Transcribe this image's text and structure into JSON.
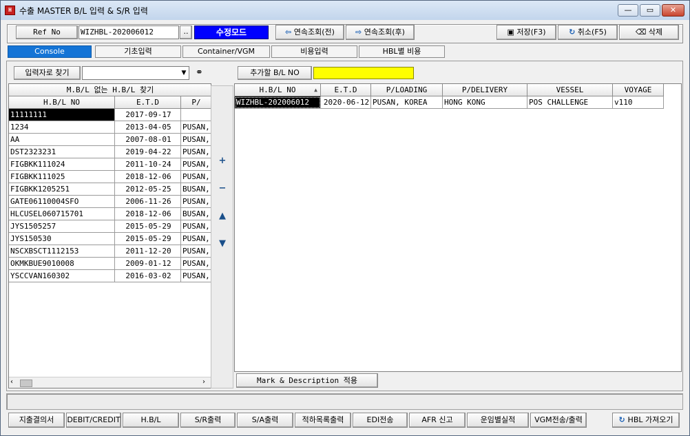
{
  "window": {
    "title": "수출 MASTER B/L 입력 & S/R 입력",
    "icon": "app-icon",
    "controls": [
      "minimize",
      "restore",
      "close"
    ]
  },
  "toolbar": {
    "ref_label": "Ref No",
    "ref_value": "WIZHBL-202006012",
    "dots": "..",
    "mode": "수정모드",
    "prev": "연속조회(전)",
    "next": "연속조회(후)",
    "save": "저장(F3)",
    "cancel": "취소(F5)",
    "delete": "삭제"
  },
  "tabs": [
    "Console",
    "기초입력",
    "Container/VGM",
    "비용입력",
    "HBL별 비용"
  ],
  "search": {
    "label": "입력자로 찾기",
    "value": "",
    "add_label": "추가할 B/L NO",
    "add_value": ""
  },
  "left": {
    "title": "M.B/L 없는 H.B/L 찾기",
    "columns": [
      "H.B/L NO",
      "E.T.D",
      "P/"
    ],
    "rows": [
      [
        "11111111",
        "2017-09-17",
        ""
      ],
      [
        "1234",
        "2013-04-05",
        "PUSAN, K"
      ],
      [
        "AA",
        "2007-08-01",
        "PUSAN, K"
      ],
      [
        "DST2323231",
        "2019-04-22",
        "PUSAN, K"
      ],
      [
        "FIGBKK111024",
        "2011-10-24",
        "PUSAN, K"
      ],
      [
        "FIGBKK111025",
        "2018-12-06",
        "PUSAN, K"
      ],
      [
        "FIGBKK1205251",
        "2012-05-25",
        "BUSAN, K"
      ],
      [
        "GATE06110004SFO",
        "2006-11-26",
        "PUSAN, K"
      ],
      [
        "HLCUSEL060715701",
        "2018-12-06",
        "BUSAN, K"
      ],
      [
        "JYS1505257",
        "2015-05-29",
        "PUSAN, K"
      ],
      [
        "JYS150530",
        "2015-05-29",
        "PUSAN, K"
      ],
      [
        "NSCXBSCT1112153",
        "2011-12-20",
        "PUSAN, K"
      ],
      [
        "OKMKBUE9010008",
        "2009-01-12",
        "PUSAN, K"
      ],
      [
        "YSCCVAN160302",
        "2016-03-02",
        "PUSAN, K"
      ]
    ]
  },
  "right": {
    "columns": [
      "H.B/L NO",
      "E.T.D",
      "P/LOADING",
      "P/DELIVERY",
      "VESSEL",
      "VOYAGE"
    ],
    "rows": [
      [
        "WIZHBL-202006012",
        "2020-06-12",
        "PUSAN, KOREA",
        "HONG KONG",
        "POS CHALLENGE",
        "v110"
      ]
    ],
    "mark_button": "Mark & Description 적용"
  },
  "center_icons": [
    "plus-icon",
    "minus-icon",
    "arrow-up-icon",
    "arrow-down-icon"
  ],
  "bottom": [
    "지출결의서",
    "DEBIT/CREDIT",
    "H.B/L",
    "S/R출력",
    "S/A출력",
    "적하목록출력",
    "EDI전송",
    "AFR 신고",
    "운임별실적",
    "VGM전송/출력",
    "HBL 가져오기"
  ],
  "colors": {
    "mode_bg": "#0000ff",
    "tab_active": "#1474d6",
    "yellow": "#ffff00",
    "selected": "#000000"
  }
}
